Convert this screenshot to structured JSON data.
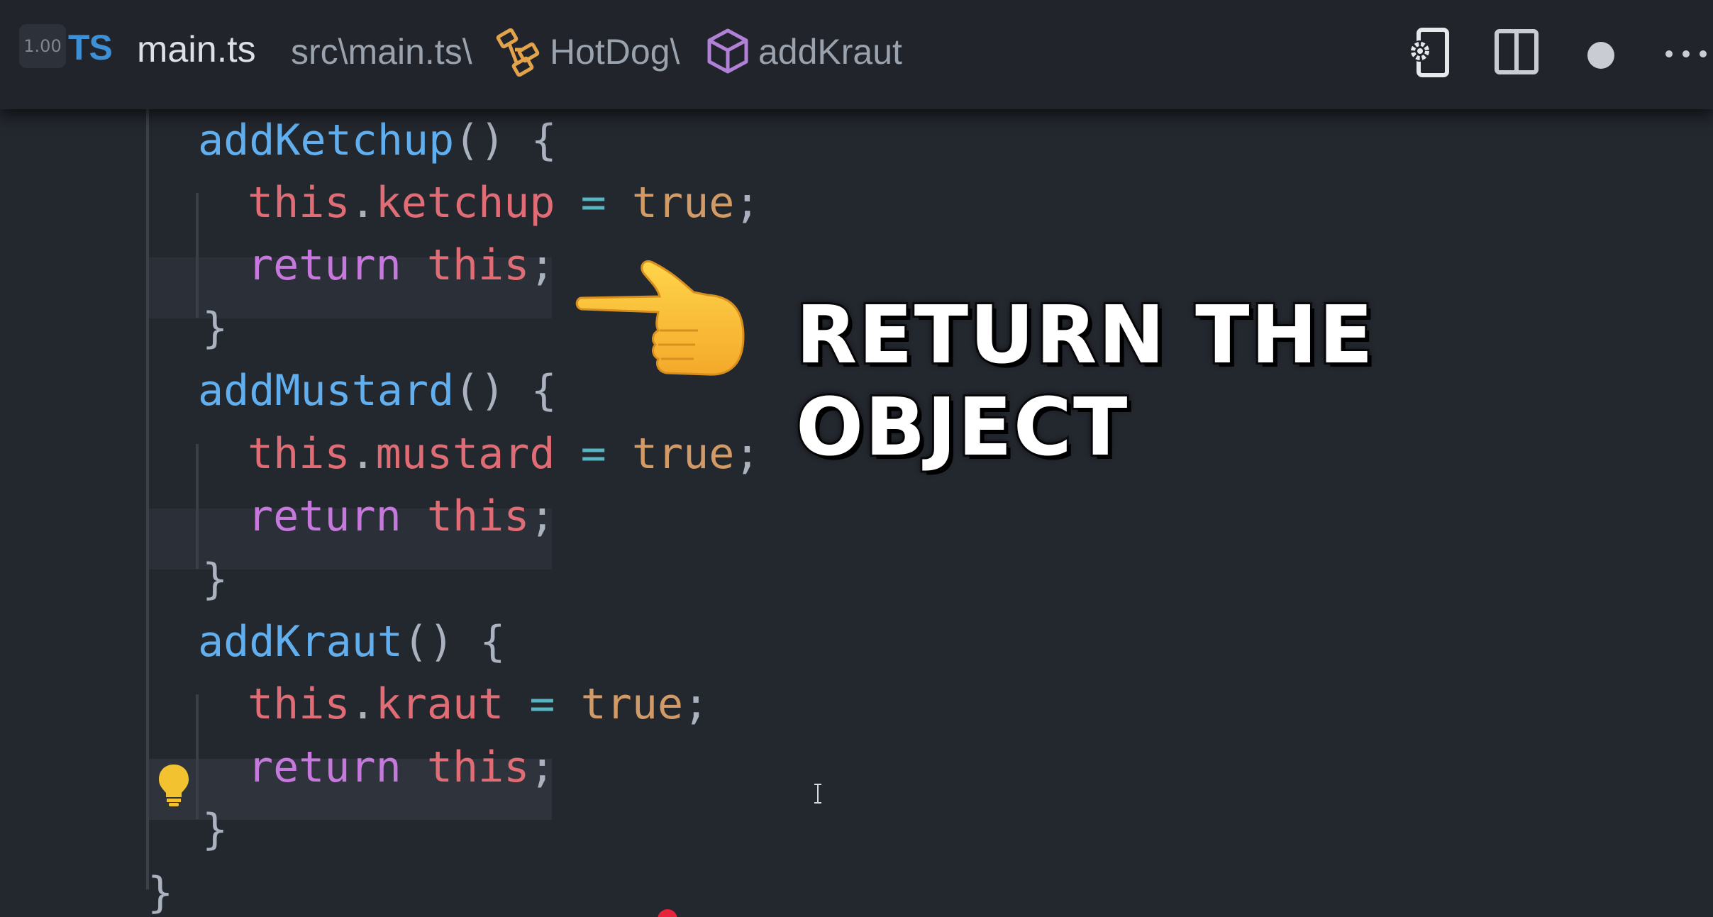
{
  "titlebar": {
    "zoom_badge": "1.00",
    "file_icon_label": "TS",
    "file_name": "main.ts",
    "breadcrumb": {
      "path": "src\\main.ts\\",
      "class_name": "HotDog\\",
      "method_name": "addKraut"
    },
    "icons": [
      "settings-icon",
      "split-editor-icon",
      "unsaved-dot-icon",
      "more-actions-icon"
    ]
  },
  "code_lines": [
    {
      "id": "l1",
      "tokens": [
        [
          "fn",
          "addKetchup"
        ],
        [
          "punct",
          "() {"
        ]
      ]
    },
    {
      "id": "l2",
      "tokens": [
        [
          "this",
          "this"
        ],
        [
          "punct",
          "."
        ],
        [
          "prop",
          "ketchup"
        ],
        [
          "punct",
          " "
        ],
        [
          "op",
          "="
        ],
        [
          "punct",
          " "
        ],
        [
          "bool",
          "true"
        ],
        [
          "punct",
          ";"
        ]
      ]
    },
    {
      "id": "l3",
      "tokens": [
        [
          "kw",
          "return"
        ],
        [
          "punct",
          " "
        ],
        [
          "this",
          "this"
        ],
        [
          "punct",
          ";"
        ]
      ]
    },
    {
      "id": "l4",
      "tokens": [
        [
          "punct",
          "}"
        ]
      ]
    },
    {
      "id": "l5",
      "tokens": [
        [
          "fn",
          "addMustard"
        ],
        [
          "punct",
          "() {"
        ]
      ]
    },
    {
      "id": "l6",
      "tokens": [
        [
          "this",
          "this"
        ],
        [
          "punct",
          "."
        ],
        [
          "prop",
          "mustard"
        ],
        [
          "punct",
          " "
        ],
        [
          "op",
          "="
        ],
        [
          "punct",
          " "
        ],
        [
          "bool",
          "true"
        ],
        [
          "punct",
          ";"
        ]
      ]
    },
    {
      "id": "l7",
      "tokens": [
        [
          "kw",
          "return"
        ],
        [
          "punct",
          " "
        ],
        [
          "this",
          "this"
        ],
        [
          "punct",
          ";"
        ]
      ]
    },
    {
      "id": "l8",
      "tokens": [
        [
          "punct",
          "}"
        ]
      ]
    },
    {
      "id": "l9",
      "tokens": [
        [
          "fn",
          "addKraut"
        ],
        [
          "punct",
          "() {"
        ]
      ]
    },
    {
      "id": "l10",
      "tokens": [
        [
          "this",
          "this"
        ],
        [
          "punct",
          "."
        ],
        [
          "prop",
          "kraut"
        ],
        [
          "punct",
          " "
        ],
        [
          "op",
          "="
        ],
        [
          "punct",
          " "
        ],
        [
          "bool",
          "true"
        ],
        [
          "punct",
          ";"
        ]
      ]
    },
    {
      "id": "l11",
      "tokens": [
        [
          "kw",
          "return"
        ],
        [
          "punct",
          " "
        ],
        [
          "this",
          "this"
        ],
        [
          "punct",
          ";"
        ]
      ]
    },
    {
      "id": "l12",
      "tokens": [
        [
          "punct",
          "}"
        ]
      ]
    },
    {
      "id": "l13",
      "tokens": [
        [
          "punct",
          "}"
        ]
      ]
    }
  ],
  "overlay": {
    "callout_text": "RETURN THE OBJECT",
    "pointer_icon": "pointing-right-hand-icon"
  },
  "colors": {
    "background": "#23272e",
    "function": "#61afef",
    "this": "#e06c75",
    "keyword": "#c678dd",
    "boolean": "#d19a66",
    "operator": "#56b6c2"
  }
}
